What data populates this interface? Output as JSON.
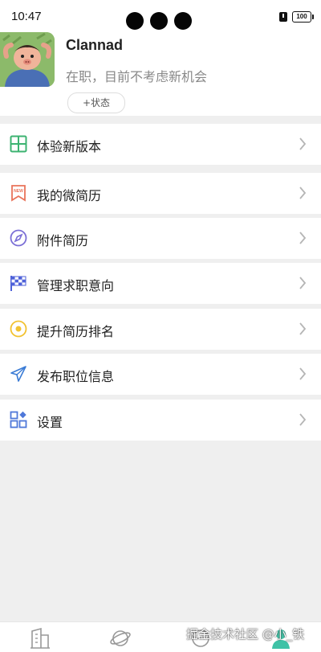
{
  "status_bar": {
    "time": "10:47",
    "battery": "100"
  },
  "profile": {
    "username": "Clannad",
    "job_status": "在职，目前不考虑新机会",
    "status_button": "+状态"
  },
  "menu": [
    {
      "label": "体验新版本",
      "icon": "grid-icon",
      "color": "#3cb371"
    },
    {
      "label": "我的微简历",
      "icon": "resume-flag-icon",
      "color": "#e9735a"
    },
    {
      "label": "附件简历",
      "icon": "compass-icon",
      "color": "#7b6fd6"
    },
    {
      "label": "管理求职意向",
      "icon": "checkered-flag-icon",
      "color": "#4f62d9"
    },
    {
      "label": "提升简历排名",
      "icon": "target-icon",
      "color": "#f2c230"
    },
    {
      "label": "发布职位信息",
      "icon": "send-icon",
      "color": "#3a7bd5"
    },
    {
      "label": "设置",
      "icon": "apps-icon",
      "color": "#4f78d9"
    }
  ],
  "tabbar": {
    "tabs": [
      "company-tab-icon",
      "discover-tab-icon",
      "message-tab-icon",
      "profile-tab-icon"
    ]
  },
  "watermark": "掘金技术社区 @小_铁"
}
